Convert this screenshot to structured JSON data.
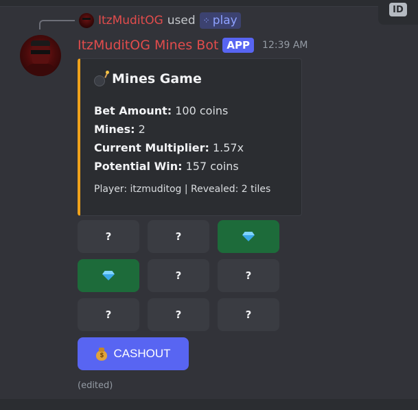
{
  "reply": {
    "user": "ItzMuditOG",
    "verb": "used",
    "command": "play"
  },
  "message": {
    "author": "ItzMuditOG Mines Bot",
    "badge": "APP",
    "timestamp": "12:39 AM",
    "edited_label": "(edited)"
  },
  "embed": {
    "accent_color": "#f0a21b",
    "title": "Mines Game",
    "fields": [
      {
        "key": "Bet Amount:",
        "value": "100 coins"
      },
      {
        "key": "Mines:",
        "value": "2"
      },
      {
        "key": "Current Multiplier:",
        "value": "1.57x"
      },
      {
        "key": "Potential Win:",
        "value": "157 coins"
      }
    ],
    "footer": "Player: itzmuditog | Revealed: 2 tiles"
  },
  "tiles": [
    {
      "label": "?",
      "state": "hidden"
    },
    {
      "label": "?",
      "state": "hidden"
    },
    {
      "label": "",
      "state": "gem"
    },
    {
      "label": "",
      "state": "gem"
    },
    {
      "label": "?",
      "state": "hidden"
    },
    {
      "label": "?",
      "state": "hidden"
    },
    {
      "label": "?",
      "state": "hidden"
    },
    {
      "label": "?",
      "state": "hidden"
    },
    {
      "label": "?",
      "state": "hidden"
    }
  ],
  "cashout": {
    "label": "CASHOUT",
    "icon": "money-bag-icon",
    "color": "#5865f2"
  },
  "colors": {
    "background": "#323339",
    "username": "#e24c4c",
    "gem_tile": "#1d6b3a",
    "hidden_tile": "#3a3c42"
  }
}
